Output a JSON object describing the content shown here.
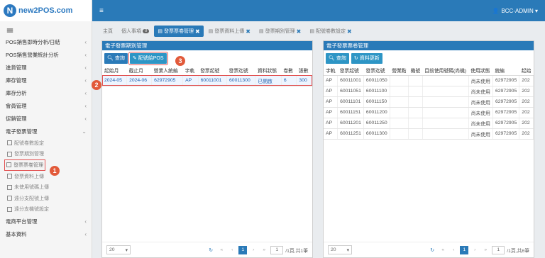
{
  "logo": {
    "brand": "new2POS.com",
    "badge": "N"
  },
  "sidebar": {
    "items": [
      {
        "label": "POS銷售即時分析/日結",
        "chev": "‹"
      },
      {
        "label": "POS銷售營業統計分析",
        "chev": "‹"
      },
      {
        "label": "進貨管理",
        "chev": "‹"
      },
      {
        "label": "庫存管理",
        "chev": "‹"
      },
      {
        "label": "庫存分析",
        "chev": "‹"
      },
      {
        "label": "會員管理",
        "chev": "‹"
      },
      {
        "label": "促銷管理",
        "chev": "‹"
      },
      {
        "label": "電子發票管理",
        "chev": "⌄"
      }
    ],
    "subitems": [
      {
        "label": "配號卷數設定"
      },
      {
        "label": "發票期別管理"
      },
      {
        "label": "發票票卷管理"
      },
      {
        "label": "發票資料上傳"
      },
      {
        "label": "未使用號碼上傳"
      },
      {
        "label": "遠分支配號上傳"
      },
      {
        "label": "遠分支機號設定"
      }
    ],
    "bottom": [
      {
        "label": "電商平台管理",
        "chev": "‹"
      },
      {
        "label": "基本資料",
        "chev": "‹"
      }
    ]
  },
  "topbar": {
    "menu": "≡",
    "user": "BCC-ADMIN ▾"
  },
  "tabs": [
    {
      "label": "主頁"
    },
    {
      "label": "個人事項",
      "count": "0"
    },
    {
      "label": "發票票卷管理",
      "close": "✖"
    },
    {
      "label": "發票資料上傳",
      "close": "✖"
    },
    {
      "label": "發票期別管理",
      "close": "✖"
    },
    {
      "label": "配號卷數設定",
      "close": "✖"
    }
  ],
  "left_panel": {
    "title": "電子發票期別管理",
    "query_btn": "查詢",
    "assign_btn": "配號給POS",
    "headers": [
      "起始月",
      "截止月",
      "營業人統編",
      "字軌",
      "發票起號",
      "發票迄號",
      "資料狀態",
      "卷數",
      "張數"
    ],
    "rows": [
      [
        "2024-05",
        "2024-06",
        "62972905",
        "AP",
        "60011001",
        "60011300",
        "已開啟",
        "6",
        "300"
      ]
    ],
    "pager": {
      "size": "20",
      "page": "1",
      "total": "/1頁,共1筆",
      "goto": "1"
    }
  },
  "right_panel": {
    "title": "電子發票票卷管理",
    "query_btn": "查詢",
    "refresh_btn": "資料更新",
    "headers": [
      "字軌",
      "發票起號",
      "發票迄號",
      "營業點",
      "機號",
      "目前使用號碼(尚機)",
      "使用狀態",
      "統編",
      "起始"
    ],
    "rows": [
      [
        "AP",
        "60011001",
        "60011050",
        "",
        "",
        "",
        "尚未使用",
        "62972905",
        "202"
      ],
      [
        "AP",
        "60011051",
        "60011100",
        "",
        "",
        "",
        "尚未使用",
        "62972905",
        "202"
      ],
      [
        "AP",
        "60011101",
        "60011150",
        "",
        "",
        "",
        "尚未使用",
        "62972905",
        "202"
      ],
      [
        "AP",
        "60011151",
        "60011200",
        "",
        "",
        "",
        "尚未使用",
        "62972905",
        "202"
      ],
      [
        "AP",
        "60011201",
        "60011250",
        "",
        "",
        "",
        "尚未使用",
        "62972905",
        "202"
      ],
      [
        "AP",
        "60011251",
        "60011300",
        "",
        "",
        "",
        "尚未使用",
        "62972905",
        "202"
      ]
    ],
    "pager": {
      "size": "20",
      "page": "1",
      "total": "/1頁,共6筆",
      "goto": "1"
    }
  },
  "callouts": [
    "1",
    "2",
    "3"
  ]
}
